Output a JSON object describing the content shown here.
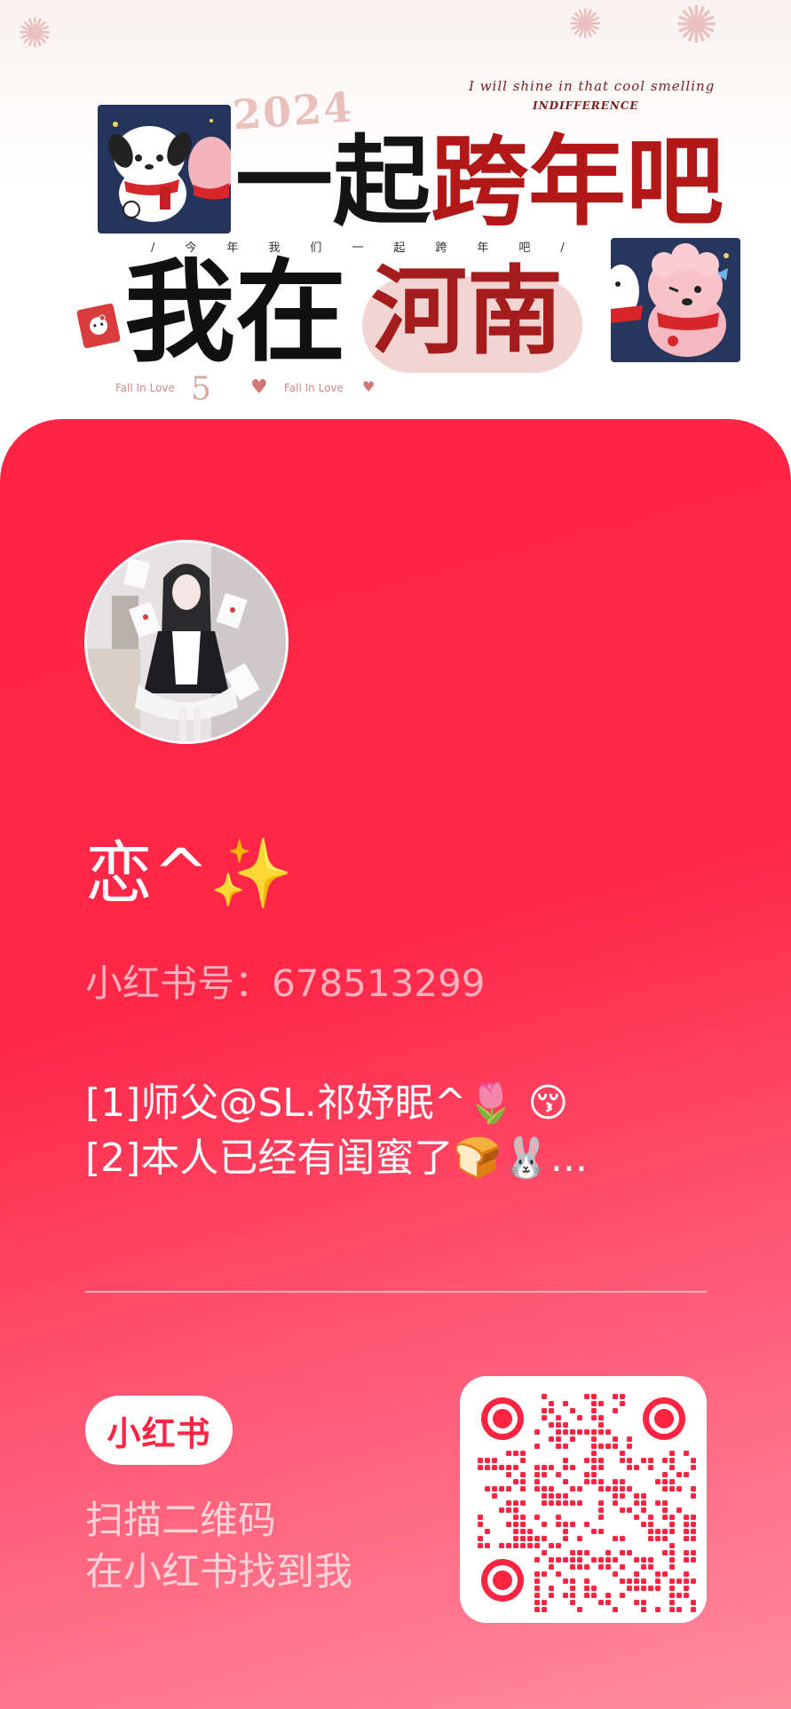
{
  "banner": {
    "year": "2024",
    "tagline_en": "I will shine in that cool smelling",
    "tagline_en2": "INDIFFERENCE",
    "headline_black": "一起",
    "headline_red": "跨年吧",
    "subline": "/今年我们一起跨年吧/",
    "headline2_black": "我在",
    "headline2_red": "河南",
    "footer_number": "5",
    "footer_text_left": "Fall In Love",
    "footer_text_right": "Fall In Love",
    "footer_heart": "♥"
  },
  "profile": {
    "nickname": "恋^✨",
    "account_id_label": "小红书号：",
    "account_id": "678513299",
    "bio_lines": [
      "[1]师父@SL.祁妤眠^🌷 😚",
      "[2]本人已经有闺蜜了🍞🐰..."
    ]
  },
  "footer": {
    "brand": "小红书",
    "scan_line1": "扫描二维码",
    "scan_line2": "在小红书找到我"
  },
  "colors": {
    "accent": "#ff2442",
    "card_top": "#ff2446",
    "card_bottom": "#ff8c9e"
  },
  "icons": {
    "qr": "qr-code-icon",
    "sparkles": "sparkles-emoji"
  }
}
